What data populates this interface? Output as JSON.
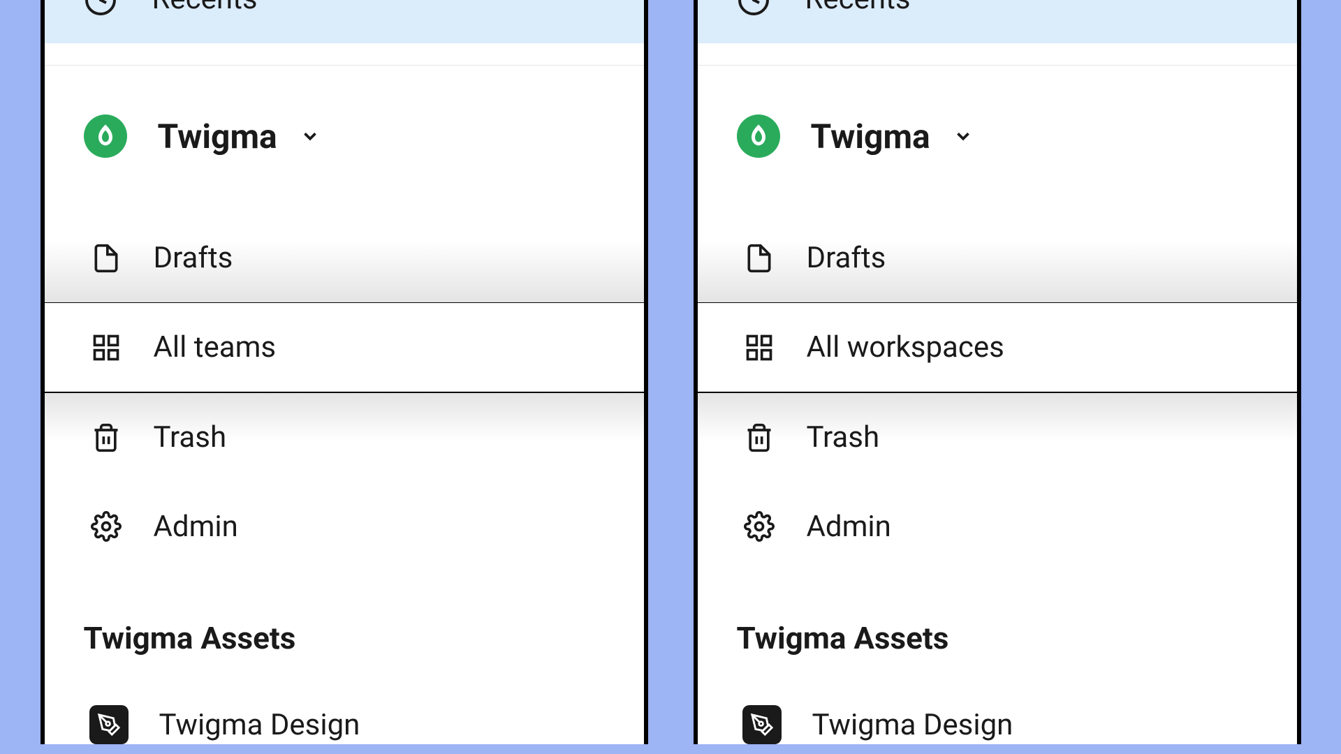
{
  "recents_label": "Recents",
  "org_name": "Twigma",
  "left": {
    "nav": {
      "drafts": "Drafts",
      "all": "All teams",
      "trash": "Trash",
      "admin": "Admin"
    }
  },
  "right": {
    "nav": {
      "drafts": "Drafts",
      "all": "All workspaces",
      "trash": "Trash",
      "admin": "Admin"
    }
  },
  "assets": {
    "heading": "Twigma Assets",
    "item1": "Twigma Design"
  }
}
